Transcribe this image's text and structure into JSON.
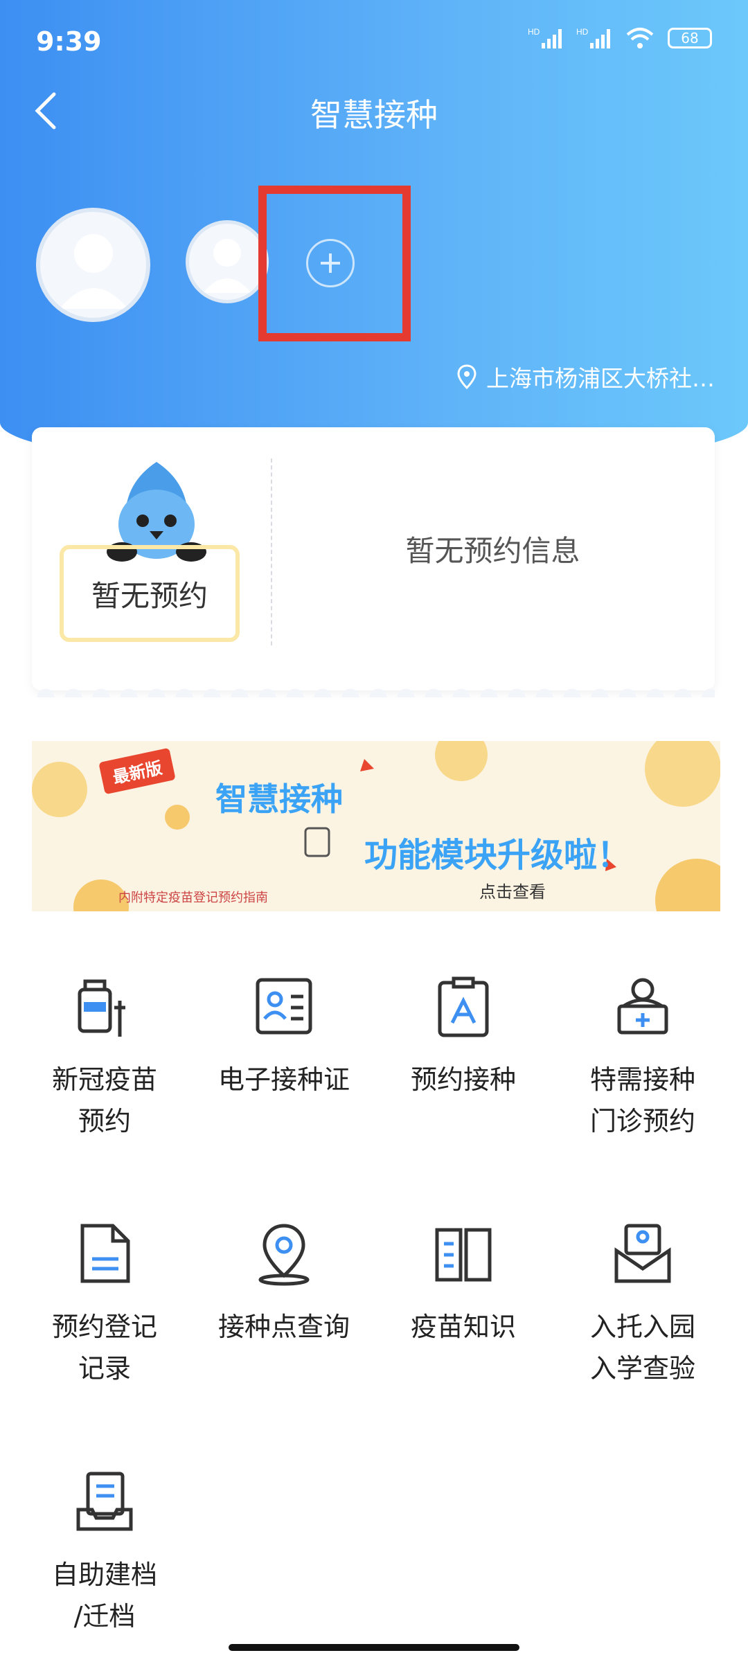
{
  "status": {
    "time": "9:39",
    "battery": "68"
  },
  "header": {
    "title": "智慧接种",
    "location": "上海市杨浦区大桥社…"
  },
  "appointment": {
    "sign_text": "暂无预约",
    "empty_text": "暂无预约信息"
  },
  "banner": {
    "tag": "最新版",
    "title": "智慧接种",
    "subtitle": "功能模块升级啦！",
    "small_note": "内附特定疫苗登记预约指南",
    "cta": "点击查看"
  },
  "grid": {
    "items": [
      {
        "line1": "新冠疫苗",
        "line2": "预约"
      },
      {
        "line1": "电子接种证",
        "line2": ""
      },
      {
        "line1": "预约接种",
        "line2": ""
      },
      {
        "line1": "特需接种",
        "line2": "门诊预约"
      },
      {
        "line1": "预约登记",
        "line2": "记录"
      },
      {
        "line1": "接种点查询",
        "line2": ""
      },
      {
        "line1": "疫苗知识",
        "line2": ""
      },
      {
        "line1": "入托入园",
        "line2": "入学查验"
      },
      {
        "line1": "自助建档",
        "line2": "/迁档"
      }
    ]
  },
  "colors": {
    "header_start": "#3d8ff2",
    "header_end": "#6cc8fb",
    "highlight_box": "#e53a2f",
    "icon_accent": "#3d8ff2"
  }
}
